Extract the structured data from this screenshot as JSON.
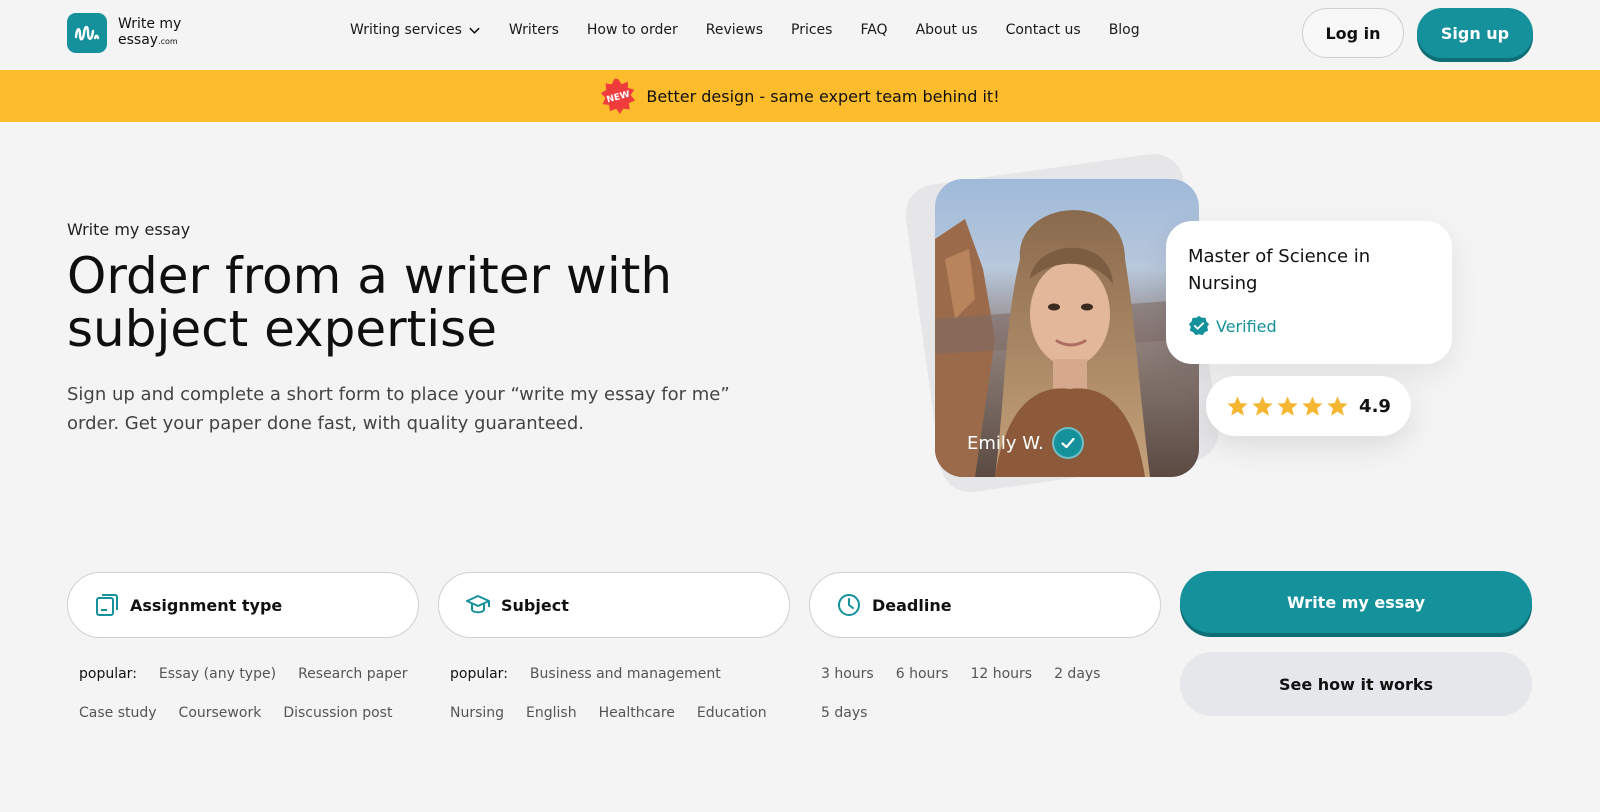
{
  "header": {
    "logo_line1": "Write my",
    "logo_line2": "essay",
    "logo_suffix": ".com",
    "nav": [
      {
        "label": "Writing services"
      },
      {
        "label": "Writers"
      },
      {
        "label": "How to order"
      },
      {
        "label": "Reviews"
      },
      {
        "label": "Prices"
      },
      {
        "label": "FAQ"
      },
      {
        "label": "About us"
      },
      {
        "label": "Contact us"
      },
      {
        "label": "Blog"
      }
    ],
    "login_label": "Log in",
    "signup_label": "Sign up"
  },
  "banner": {
    "badge_text": "NEW",
    "text": "Better design - same expert team behind it!"
  },
  "hero": {
    "eyebrow": "Write my essay",
    "title": "Order from a writer with subject expertise",
    "subtitle": "Sign up and complete a short form to place your “write my essay for me” order. Get your paper done fast, with quality guaranteed."
  },
  "writer": {
    "name": "Emily W.",
    "degree": "Master of Science in Nursing",
    "verified_label": "Verified",
    "rating": "4.9",
    "stars": 5
  },
  "form": {
    "assignment": {
      "label": "Assignment type",
      "popular_label": "popular:",
      "options": [
        "Essay (any type)",
        "Research paper",
        "Case study",
        "Coursework",
        "Discussion post"
      ]
    },
    "subject": {
      "label": "Subject",
      "popular_label": "popular:",
      "options": [
        "Business and management",
        "Nursing",
        "English",
        "Healthcare",
        "Education"
      ]
    },
    "deadline": {
      "label": "Deadline",
      "options": [
        "3 hours",
        "6 hours",
        "12 hours",
        "2 days",
        "5 days"
      ]
    },
    "submit_label": "Write my essay",
    "how_label": "See how it works"
  },
  "colors": {
    "accent": "#14919b",
    "banner": "#fdbc2c",
    "star": "#f5b731",
    "background": "#f4f4f4"
  }
}
